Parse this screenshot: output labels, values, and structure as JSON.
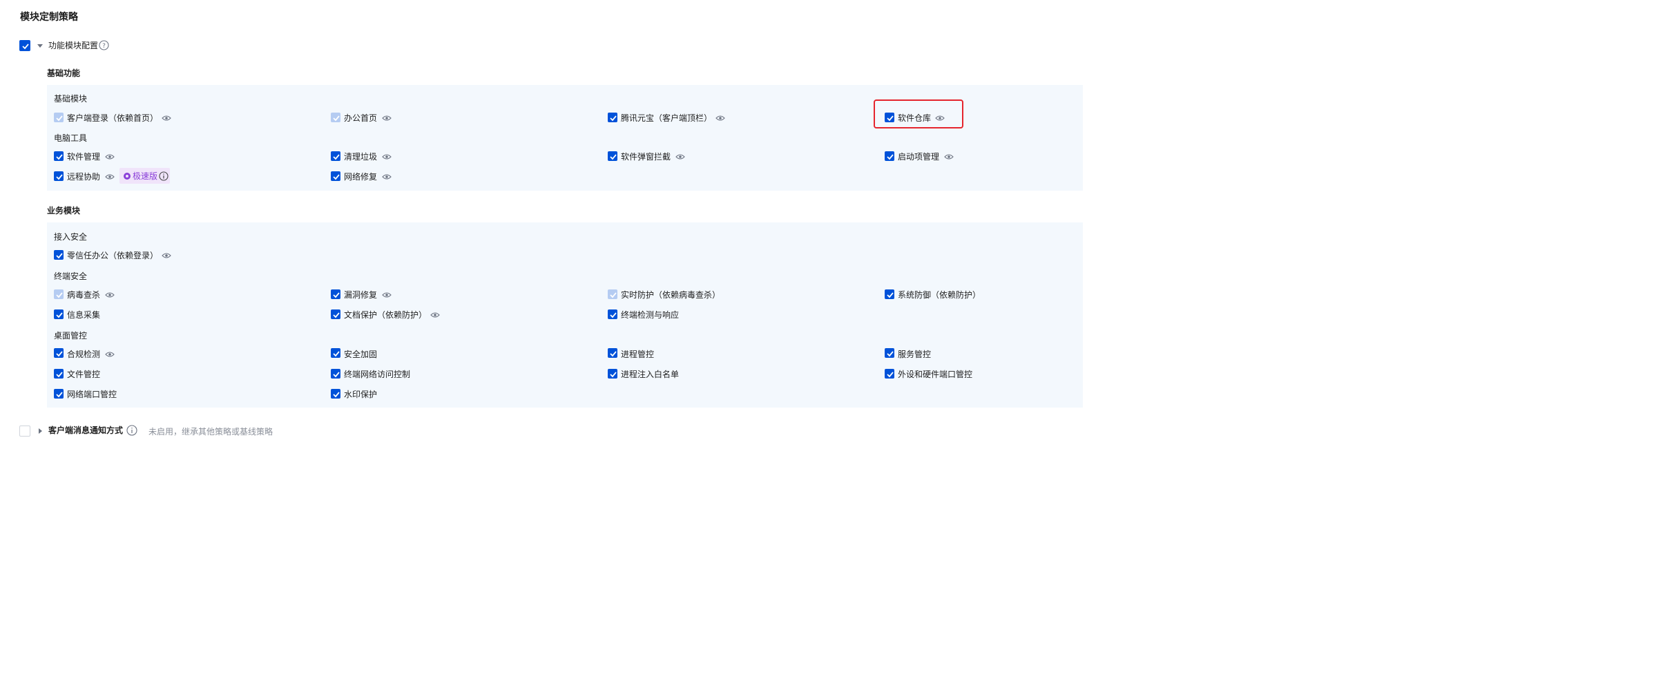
{
  "page_title": "模块定制策略",
  "func_config": {
    "label": "功能模块配置",
    "checked": true
  },
  "basic_functions": {
    "title": "基础功能",
    "groups": [
      {
        "title": "基础模块",
        "items": [
          {
            "label": "客户端登录（依赖首页）",
            "state": "locked",
            "eye": true
          },
          {
            "label": "办公首页",
            "state": "locked",
            "eye": true
          },
          {
            "label": "腾讯元宝（客户端顶栏）",
            "state": "checked",
            "eye": true
          },
          {
            "label": "软件仓库",
            "state": "checked",
            "eye": true,
            "highlighted": true
          }
        ]
      },
      {
        "title": "电脑工具",
        "items": [
          {
            "label": "软件管理",
            "state": "checked",
            "eye": true
          },
          {
            "label": "清理垃圾",
            "state": "checked",
            "eye": true
          },
          {
            "label": "软件弹窗拦截",
            "state": "checked",
            "eye": true
          },
          {
            "label": "启动项管理",
            "state": "checked",
            "eye": true
          },
          {
            "label": "远程协助",
            "state": "checked",
            "eye": true,
            "badge": "极速版"
          },
          {
            "label": "网络修复",
            "state": "checked",
            "eye": true
          }
        ]
      }
    ]
  },
  "business_modules": {
    "title": "业务模块",
    "groups": [
      {
        "title": "接入安全",
        "items": [
          {
            "label": "零信任办公（依赖登录）",
            "state": "checked",
            "eye": true
          }
        ]
      },
      {
        "title": "终端安全",
        "items": [
          {
            "label": "病毒查杀",
            "state": "locked",
            "eye": true
          },
          {
            "label": "漏洞修复",
            "state": "checked",
            "eye": true
          },
          {
            "label": "实时防护（依赖病毒查杀）",
            "state": "locked",
            "eye": false
          },
          {
            "label": "系统防御（依赖防护）",
            "state": "checked",
            "eye": false
          },
          {
            "label": "信息采集",
            "state": "checked",
            "eye": false
          },
          {
            "label": "文档保护（依赖防护）",
            "state": "checked",
            "eye": true
          },
          {
            "label": "终端检测与响应",
            "state": "checked",
            "eye": false
          }
        ]
      },
      {
        "title": "桌面管控",
        "items": [
          {
            "label": "合规检测",
            "state": "checked",
            "eye": true
          },
          {
            "label": "安全加固",
            "state": "checked",
            "eye": false
          },
          {
            "label": "进程管控",
            "state": "checked",
            "eye": false
          },
          {
            "label": "服务管控",
            "state": "checked",
            "eye": false
          },
          {
            "label": "文件管控",
            "state": "checked",
            "eye": false
          },
          {
            "label": "终端网络访问控制",
            "state": "checked",
            "eye": false
          },
          {
            "label": "进程注入白名单",
            "state": "checked",
            "eye": false
          },
          {
            "label": "外设和硬件端口管控",
            "state": "checked",
            "eye": false
          },
          {
            "label": "网络端口管控",
            "state": "checked",
            "eye": false
          },
          {
            "label": "水印保护",
            "state": "checked",
            "eye": false
          }
        ]
      }
    ]
  },
  "client_notify": {
    "label": "客户端消息通知方式",
    "checked": false,
    "hint": "未启用，继承其他策略或基线策略"
  },
  "colors": {
    "primary": "#0052d9",
    "panel_bg": "#f3f8fd",
    "highlight": "#e5252d",
    "badge_bg": "#f0e4fa",
    "badge_text": "#8b3fd9"
  }
}
